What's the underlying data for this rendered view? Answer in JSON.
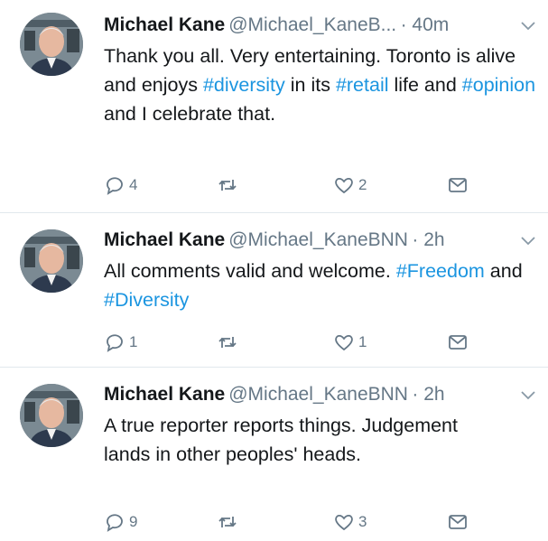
{
  "tweets": [
    {
      "name": "Michael Kane",
      "handle": "@Michael_KaneB...",
      "time": "· 40m",
      "text": [
        {
          "t": "Thank you all. Very entertaining. Toronto is alive and enjoys ",
          "tag": false
        },
        {
          "t": "#diversity",
          "tag": true
        },
        {
          "t": "  in its ",
          "tag": false
        },
        {
          "t": "#retail",
          "tag": true
        },
        {
          "t": " life and ",
          "tag": false
        },
        {
          "t": "#opinion",
          "tag": true
        },
        {
          "t": " and I celebrate that.",
          "tag": false
        }
      ],
      "replies": "4",
      "retweets": "",
      "likes": "2"
    },
    {
      "name": "Michael Kane",
      "handle": "@Michael_KaneBNN",
      "time": "· 2h",
      "text": [
        {
          "t": "All comments valid and welcome. ",
          "tag": false
        },
        {
          "t": "#Freedom",
          "tag": true
        },
        {
          "t": " and ",
          "tag": false
        },
        {
          "t": "#Diversity",
          "tag": true
        }
      ],
      "replies": "1",
      "retweets": "",
      "likes": "1"
    },
    {
      "name": "Michael Kane",
      "handle": "@Michael_KaneBNN",
      "time": "· 2h",
      "text": [
        {
          "t": "A true reporter reports things. Judgement lands in other peoples' heads.",
          "tag": false
        }
      ],
      "replies": "9",
      "retweets": "",
      "likes": "3"
    }
  ],
  "colors": {
    "link": "#1b95e0",
    "muted": "#657786",
    "text": "#14171a",
    "divider": "#e1e8ed"
  },
  "icons": [
    "reply-icon",
    "retweet-icon",
    "like-icon",
    "message-icon",
    "chevron-down-icon"
  ]
}
